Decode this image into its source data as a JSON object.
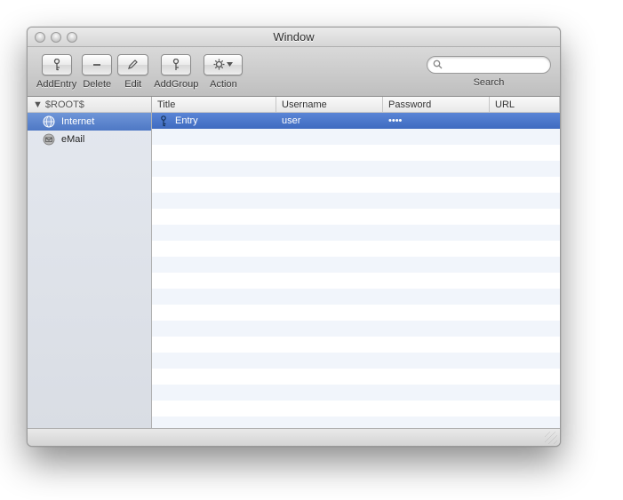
{
  "window": {
    "title": "Window"
  },
  "toolbar": {
    "addEntry": "AddEntry",
    "delete": "Delete",
    "edit": "Edit",
    "addGroup": "AddGroup",
    "action": "Action",
    "searchLabel": "Search",
    "searchValue": ""
  },
  "sidebar": {
    "root": "$ROOT$",
    "items": [
      {
        "label": "Internet",
        "icon": "globe-icon",
        "selected": true
      },
      {
        "label": "eMail",
        "icon": "mail-icon",
        "selected": false
      }
    ]
  },
  "columns": {
    "title": "Title",
    "username": "Username",
    "password": "Password",
    "url": "URL"
  },
  "entries": [
    {
      "title": "Entry",
      "username": "user",
      "password": "••••",
      "url": ""
    }
  ]
}
